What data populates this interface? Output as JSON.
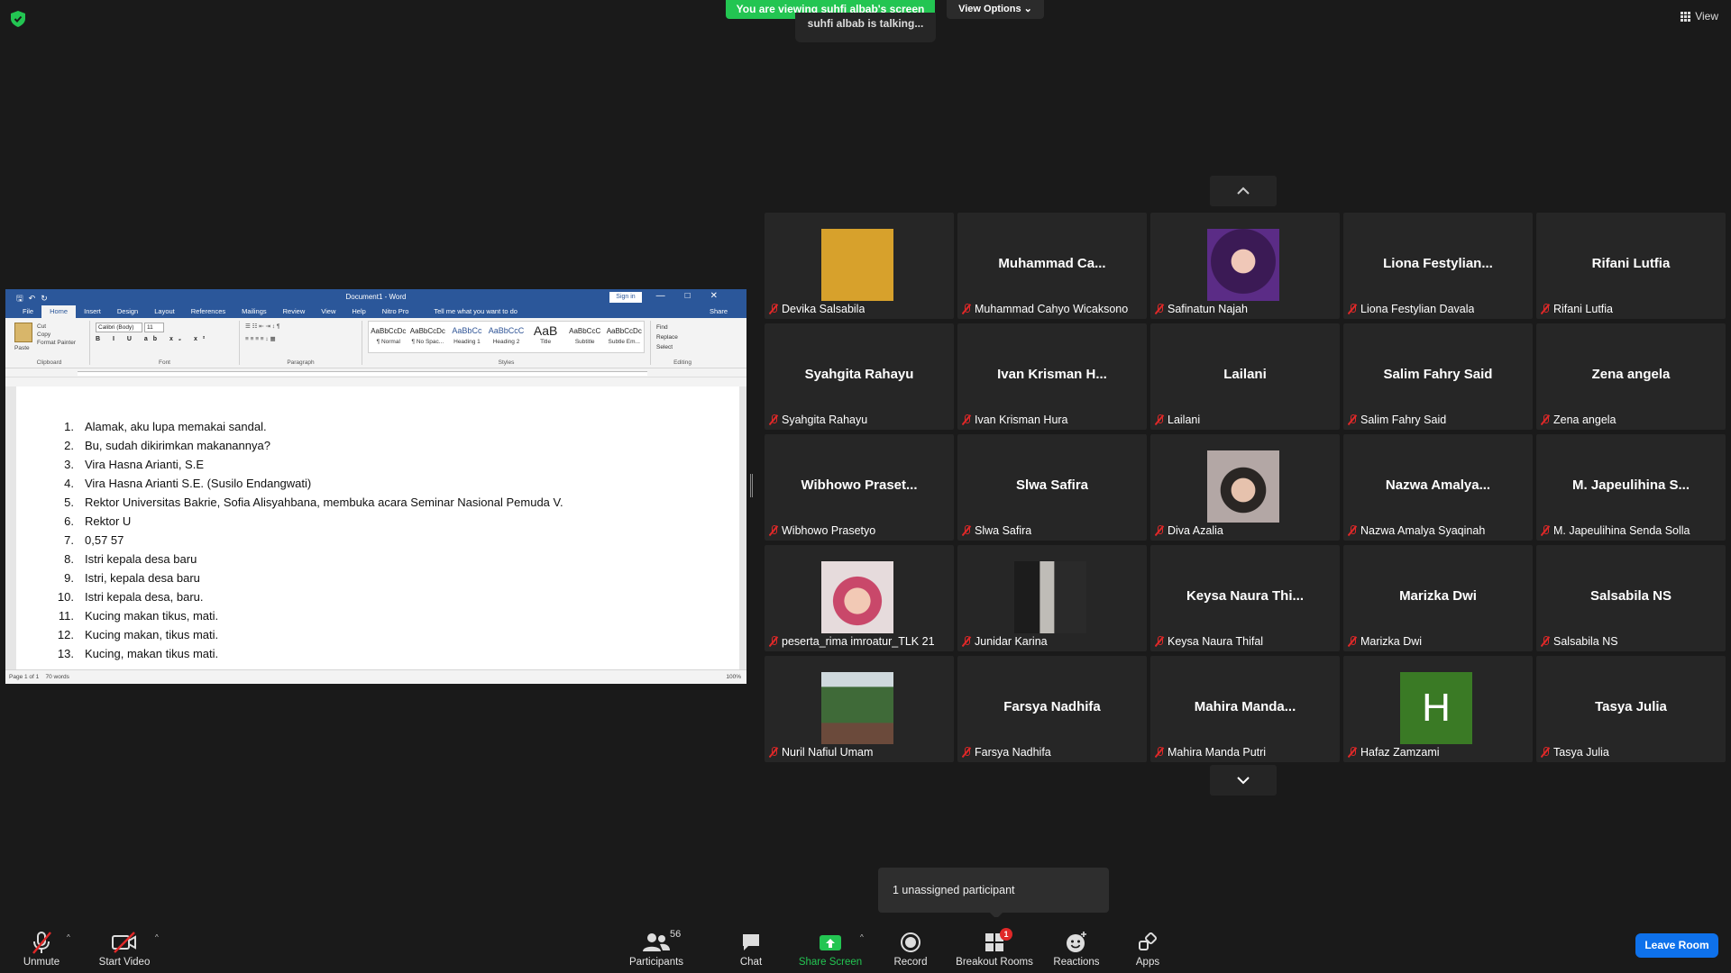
{
  "top": {
    "viewing": "You are viewing suhfi albab's screen",
    "view_options": "View Options",
    "talking": "suhfi albab is talking...",
    "view": "View"
  },
  "word": {
    "doc_title": "Document1 - Word",
    "sign_in": "Sign in",
    "tabs": [
      "File",
      "Home",
      "Insert",
      "Design",
      "Layout",
      "References",
      "Mailings",
      "Review",
      "View",
      "Help",
      "Nitro Pro"
    ],
    "tell": "Tell me what you want to do",
    "share": "Share",
    "clipboard": {
      "paste": "Paste",
      "cut": "Cut",
      "copy": "Copy",
      "painter": "Format Painter",
      "label": "Clipboard"
    },
    "font": {
      "name": "Calibri (Body)",
      "size": "11",
      "label": "Font"
    },
    "paragraph_label": "Paragraph",
    "styles_label": "Styles",
    "styles": [
      {
        "preview": "AaBbCcDc",
        "name": "¶ Normal"
      },
      {
        "preview": "AaBbCcDc",
        "name": "¶ No Spac..."
      },
      {
        "preview": "AaBbCc",
        "name": "Heading 1"
      },
      {
        "preview": "AaBbCcC",
        "name": "Heading 2"
      },
      {
        "preview": "AaB",
        "name": "Title"
      },
      {
        "preview": "AaBbCcC",
        "name": "Subtitle"
      },
      {
        "preview": "AaBbCcDc",
        "name": "Subtle Em..."
      }
    ],
    "editing": {
      "find": "Find",
      "replace": "Replace",
      "select": "Select",
      "label": "Editing"
    },
    "lines": [
      {
        "n": "1.",
        "t": "Alamak, aku lupa memakai sandal."
      },
      {
        "n": "2.",
        "t": "Bu, sudah dikirimkan makanannya?"
      },
      {
        "n": "3.",
        "t": "Vira Hasna Arianti, S.E"
      },
      {
        "n": "4.",
        "t": "Vira Hasna Arianti S.E. (Susilo Endangwati)"
      },
      {
        "n": "5.",
        "t": "Rektor Universitas Bakrie, Sofia Alisyahbana, membuka acara Seminar Nasional Pemuda V."
      },
      {
        "n": "6.",
        "t": "Rektor U"
      },
      {
        "n": "7.",
        "t": "0,57   57"
      },
      {
        "n": "8.",
        "t": "Istri kepala desa baru"
      },
      {
        "n": "9.",
        "t": "Istri, kepala desa baru"
      },
      {
        "n": "10.",
        "t": "Istri kepala desa, baru."
      },
      {
        "n": "11.",
        "t": "Kucing makan tikus, mati."
      },
      {
        "n": "12.",
        "t": "Kucing makan, tikus mati."
      },
      {
        "n": "13.",
        "t": "Kucing, makan tikus mati."
      }
    ],
    "status_page": "Page 1 of 1",
    "status_words": "70 words",
    "zoom": "100%"
  },
  "participants": [
    {
      "big": "",
      "label": "Devika Salsabila",
      "avatar": "yellow-photo"
    },
    {
      "big": "Muhammad  Ca...",
      "label": "Muhammad Cahyo Wicaksono"
    },
    {
      "big": "",
      "label": "Safinatun Najah",
      "avatar": "purple-photo"
    },
    {
      "big": "Liona  Festylian...",
      "label": "Liona Festylian Davala"
    },
    {
      "big": "Rifani Lutfia",
      "label": "Rifani Lutfia"
    },
    {
      "big": "Syahgita Rahayu",
      "label": "Syahgita Rahayu"
    },
    {
      "big": "Ivan  Krisman H...",
      "label": "Ivan Krisman Hura"
    },
    {
      "big": "Lailani",
      "label": "Lailani"
    },
    {
      "big": "Salim Fahry Said",
      "label": "Salim Fahry Said"
    },
    {
      "big": "Zena angela",
      "label": "Zena angela"
    },
    {
      "big": "Wibhowo  Praset...",
      "label": "Wibhowo Prasetyo"
    },
    {
      "big": "Slwa Safira",
      "label": "Slwa Safira"
    },
    {
      "big": "",
      "label": "Diva Azalia",
      "avatar": "hat-photo"
    },
    {
      "big": "Nazwa  Amalya...",
      "label": "Nazwa Amalya Syaqinah"
    },
    {
      "big": "M. Japeulihina  S...",
      "label": "M. Japeulihina Senda Solla"
    },
    {
      "big": "",
      "label": "peserta_rima imroatur_TLK 21",
      "avatar": "hijab-photo"
    },
    {
      "big": "",
      "label": "Junidar Karina",
      "avatar": "dark-photo"
    },
    {
      "big": "Keysa  Naura  Thi...",
      "label": "Keysa Naura Thifal"
    },
    {
      "big": "Marizka Dwi",
      "label": "Marizka Dwi"
    },
    {
      "big": "Salsabila NS",
      "label": "Salsabila NS"
    },
    {
      "big": "",
      "label": "Nuril Nafiul Umam",
      "avatar": "forest-photo"
    },
    {
      "big": "Farsya Nadhifa",
      "label": "Farsya Nadhifa"
    },
    {
      "big": "Mahira  Manda...",
      "label": "Mahira Manda Putri"
    },
    {
      "big": "",
      "label": "Hafaz Zamzami",
      "avatar": "letter",
      "letter": "H"
    },
    {
      "big": "Tasya Julia",
      "label": "Tasya Julia"
    }
  ],
  "tooltip": "1 unassigned participant",
  "toolbar": {
    "unmute": "Unmute",
    "start_video": "Start Video",
    "participants": "Participants",
    "participants_count": "56",
    "chat": "Chat",
    "share_screen": "Share Screen",
    "record": "Record",
    "breakout": "Breakout Rooms",
    "breakout_badge": "1",
    "reactions": "Reactions",
    "apps": "Apps",
    "leave": "Leave Room"
  },
  "colors": {
    "share_green": "#23c552",
    "leave_blue": "#0e71eb",
    "mute_red": "#e02828",
    "word_blue": "#2b579a"
  }
}
